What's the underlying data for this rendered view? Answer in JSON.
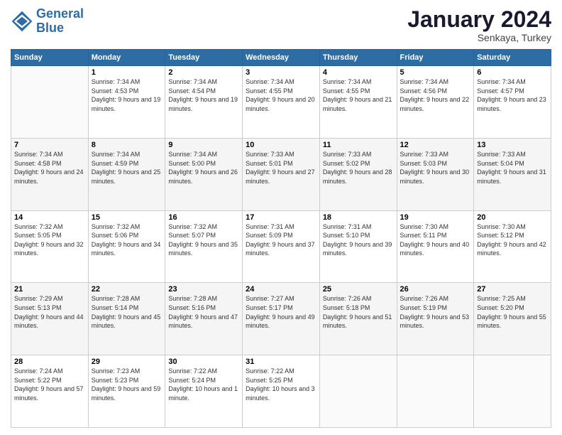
{
  "logo": {
    "line1": "General",
    "line2": "Blue"
  },
  "title": {
    "main": "January 2024",
    "sub": "Senkaya, Turkey"
  },
  "weekdays": [
    "Sunday",
    "Monday",
    "Tuesday",
    "Wednesday",
    "Thursday",
    "Friday",
    "Saturday"
  ],
  "weeks": [
    [
      {
        "day": "",
        "sunrise": "",
        "sunset": "",
        "daylight": ""
      },
      {
        "day": "1",
        "sunrise": "Sunrise: 7:34 AM",
        "sunset": "Sunset: 4:53 PM",
        "daylight": "Daylight: 9 hours and 19 minutes."
      },
      {
        "day": "2",
        "sunrise": "Sunrise: 7:34 AM",
        "sunset": "Sunset: 4:54 PM",
        "daylight": "Daylight: 9 hours and 19 minutes."
      },
      {
        "day": "3",
        "sunrise": "Sunrise: 7:34 AM",
        "sunset": "Sunset: 4:55 PM",
        "daylight": "Daylight: 9 hours and 20 minutes."
      },
      {
        "day": "4",
        "sunrise": "Sunrise: 7:34 AM",
        "sunset": "Sunset: 4:55 PM",
        "daylight": "Daylight: 9 hours and 21 minutes."
      },
      {
        "day": "5",
        "sunrise": "Sunrise: 7:34 AM",
        "sunset": "Sunset: 4:56 PM",
        "daylight": "Daylight: 9 hours and 22 minutes."
      },
      {
        "day": "6",
        "sunrise": "Sunrise: 7:34 AM",
        "sunset": "Sunset: 4:57 PM",
        "daylight": "Daylight: 9 hours and 23 minutes."
      }
    ],
    [
      {
        "day": "7",
        "sunrise": "Sunrise: 7:34 AM",
        "sunset": "Sunset: 4:58 PM",
        "daylight": "Daylight: 9 hours and 24 minutes."
      },
      {
        "day": "8",
        "sunrise": "Sunrise: 7:34 AM",
        "sunset": "Sunset: 4:59 PM",
        "daylight": "Daylight: 9 hours and 25 minutes."
      },
      {
        "day": "9",
        "sunrise": "Sunrise: 7:34 AM",
        "sunset": "Sunset: 5:00 PM",
        "daylight": "Daylight: 9 hours and 26 minutes."
      },
      {
        "day": "10",
        "sunrise": "Sunrise: 7:33 AM",
        "sunset": "Sunset: 5:01 PM",
        "daylight": "Daylight: 9 hours and 27 minutes."
      },
      {
        "day": "11",
        "sunrise": "Sunrise: 7:33 AM",
        "sunset": "Sunset: 5:02 PM",
        "daylight": "Daylight: 9 hours and 28 minutes."
      },
      {
        "day": "12",
        "sunrise": "Sunrise: 7:33 AM",
        "sunset": "Sunset: 5:03 PM",
        "daylight": "Daylight: 9 hours and 30 minutes."
      },
      {
        "day": "13",
        "sunrise": "Sunrise: 7:33 AM",
        "sunset": "Sunset: 5:04 PM",
        "daylight": "Daylight: 9 hours and 31 minutes."
      }
    ],
    [
      {
        "day": "14",
        "sunrise": "Sunrise: 7:32 AM",
        "sunset": "Sunset: 5:05 PM",
        "daylight": "Daylight: 9 hours and 32 minutes."
      },
      {
        "day": "15",
        "sunrise": "Sunrise: 7:32 AM",
        "sunset": "Sunset: 5:06 PM",
        "daylight": "Daylight: 9 hours and 34 minutes."
      },
      {
        "day": "16",
        "sunrise": "Sunrise: 7:32 AM",
        "sunset": "Sunset: 5:07 PM",
        "daylight": "Daylight: 9 hours and 35 minutes."
      },
      {
        "day": "17",
        "sunrise": "Sunrise: 7:31 AM",
        "sunset": "Sunset: 5:09 PM",
        "daylight": "Daylight: 9 hours and 37 minutes."
      },
      {
        "day": "18",
        "sunrise": "Sunrise: 7:31 AM",
        "sunset": "Sunset: 5:10 PM",
        "daylight": "Daylight: 9 hours and 39 minutes."
      },
      {
        "day": "19",
        "sunrise": "Sunrise: 7:30 AM",
        "sunset": "Sunset: 5:11 PM",
        "daylight": "Daylight: 9 hours and 40 minutes."
      },
      {
        "day": "20",
        "sunrise": "Sunrise: 7:30 AM",
        "sunset": "Sunset: 5:12 PM",
        "daylight": "Daylight: 9 hours and 42 minutes."
      }
    ],
    [
      {
        "day": "21",
        "sunrise": "Sunrise: 7:29 AM",
        "sunset": "Sunset: 5:13 PM",
        "daylight": "Daylight: 9 hours and 44 minutes."
      },
      {
        "day": "22",
        "sunrise": "Sunrise: 7:28 AM",
        "sunset": "Sunset: 5:14 PM",
        "daylight": "Daylight: 9 hours and 45 minutes."
      },
      {
        "day": "23",
        "sunrise": "Sunrise: 7:28 AM",
        "sunset": "Sunset: 5:16 PM",
        "daylight": "Daylight: 9 hours and 47 minutes."
      },
      {
        "day": "24",
        "sunrise": "Sunrise: 7:27 AM",
        "sunset": "Sunset: 5:17 PM",
        "daylight": "Daylight: 9 hours and 49 minutes."
      },
      {
        "day": "25",
        "sunrise": "Sunrise: 7:26 AM",
        "sunset": "Sunset: 5:18 PM",
        "daylight": "Daylight: 9 hours and 51 minutes."
      },
      {
        "day": "26",
        "sunrise": "Sunrise: 7:26 AM",
        "sunset": "Sunset: 5:19 PM",
        "daylight": "Daylight: 9 hours and 53 minutes."
      },
      {
        "day": "27",
        "sunrise": "Sunrise: 7:25 AM",
        "sunset": "Sunset: 5:20 PM",
        "daylight": "Daylight: 9 hours and 55 minutes."
      }
    ],
    [
      {
        "day": "28",
        "sunrise": "Sunrise: 7:24 AM",
        "sunset": "Sunset: 5:22 PM",
        "daylight": "Daylight: 9 hours and 57 minutes."
      },
      {
        "day": "29",
        "sunrise": "Sunrise: 7:23 AM",
        "sunset": "Sunset: 5:23 PM",
        "daylight": "Daylight: 9 hours and 59 minutes."
      },
      {
        "day": "30",
        "sunrise": "Sunrise: 7:22 AM",
        "sunset": "Sunset: 5:24 PM",
        "daylight": "Daylight: 10 hours and 1 minute."
      },
      {
        "day": "31",
        "sunrise": "Sunrise: 7:22 AM",
        "sunset": "Sunset: 5:25 PM",
        "daylight": "Daylight: 10 hours and 3 minutes."
      },
      {
        "day": "",
        "sunrise": "",
        "sunset": "",
        "daylight": ""
      },
      {
        "day": "",
        "sunrise": "",
        "sunset": "",
        "daylight": ""
      },
      {
        "day": "",
        "sunrise": "",
        "sunset": "",
        "daylight": ""
      }
    ]
  ]
}
